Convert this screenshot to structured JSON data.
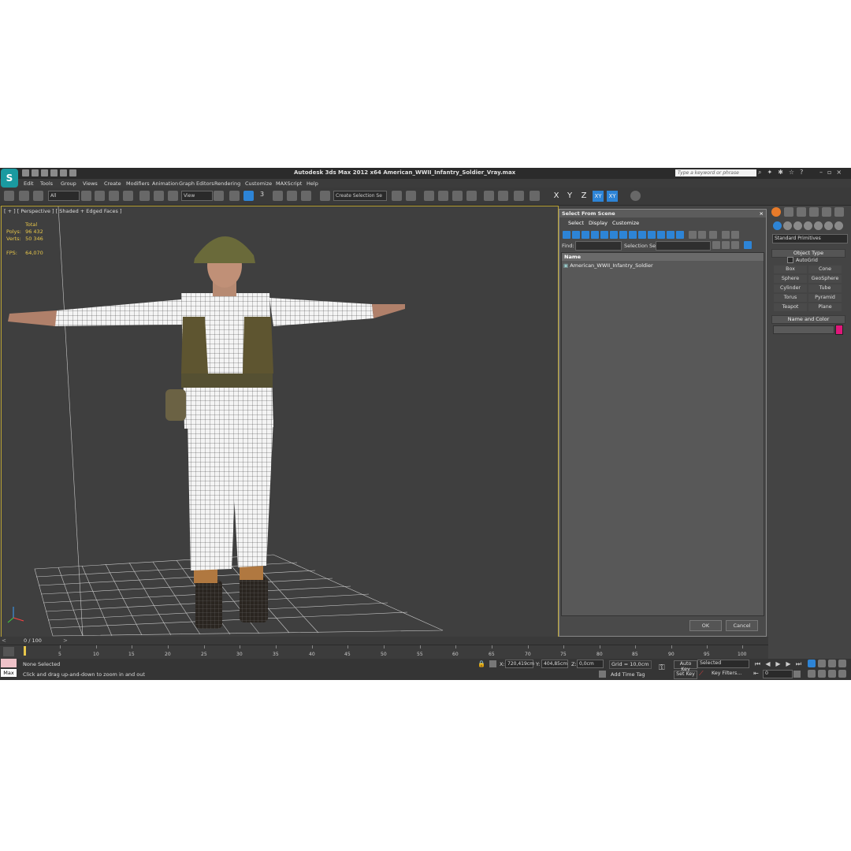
{
  "window": {
    "title": "Autodesk 3ds Max  2012 x64      American_WWII_Infantry_Soldier_Vray.max",
    "search_placeholder": "Type a keyword or phrase",
    "logo": "3ds-max-logo"
  },
  "menu": [
    "Edit",
    "Tools",
    "Group",
    "Views",
    "Create",
    "Modifiers",
    "Animation",
    "Graph Editors",
    "Rendering",
    "Customize",
    "MAXScript",
    "Help"
  ],
  "toolbar": {
    "filter_value": "All",
    "reference_coord": "View",
    "snap_label": "3",
    "selection_set_placeholder": "Create Selection Se",
    "axis_x": "X",
    "axis_y": "Y",
    "axis_z": "Z",
    "axis_xy": "XY",
    "axis_xy2": "XY"
  },
  "viewport": {
    "label": "[ + ] [ Perspective ] [ Shaded + Edged Faces ]",
    "stats": {
      "total_label": "Total",
      "polys_label": "Polys:",
      "polys": "96 432",
      "verts_label": "Verts:",
      "verts": "50 346",
      "fps_label": "FPS:",
      "fps": "64,070"
    }
  },
  "dialog": {
    "title": "Select From Scene",
    "menu": [
      "Select",
      "Display",
      "Customize"
    ],
    "find_label": "Find:",
    "selection_set_label": "Selection Set:",
    "column_name": "Name",
    "rows": [
      "American_WWII_Infantry_Soldier"
    ],
    "ok": "OK",
    "cancel": "Cancel"
  },
  "command_panel": {
    "category": "Standard Primitives",
    "object_type_header": "Object Type",
    "autogrid": "AutoGrid",
    "primitives": [
      "Box",
      "Cone",
      "Sphere",
      "GeoSphere",
      "Cylinder",
      "Tube",
      "Torus",
      "Pyramid",
      "Teapot",
      "Plane"
    ],
    "name_color_header": "Name and Color",
    "object_color": "#e0177a"
  },
  "timeline": {
    "frame_counter": "0 / 100",
    "ticks": [
      "5",
      "10",
      "15",
      "20",
      "25",
      "30",
      "35",
      "40",
      "45",
      "50",
      "55",
      "60",
      "65",
      "70",
      "75",
      "80",
      "85",
      "90",
      "95",
      "100"
    ]
  },
  "status": {
    "maxscript_label": "Max",
    "selection": "None Selected",
    "prompt": "Click and drag up-and-down to zoom in and out",
    "x_label": "X:",
    "x": "720,419cm",
    "y_label": "Y:",
    "y": "404,85cm",
    "z_label": "Z:",
    "z": "0,0cm",
    "grid": "Grid = 10,0cm",
    "add_time_tag": "Add Time Tag",
    "auto_key": "Auto Key",
    "set_key": "Set Key",
    "key_mode": "Selected",
    "key_filters": "Key Filters...",
    "current_frame": "0"
  }
}
